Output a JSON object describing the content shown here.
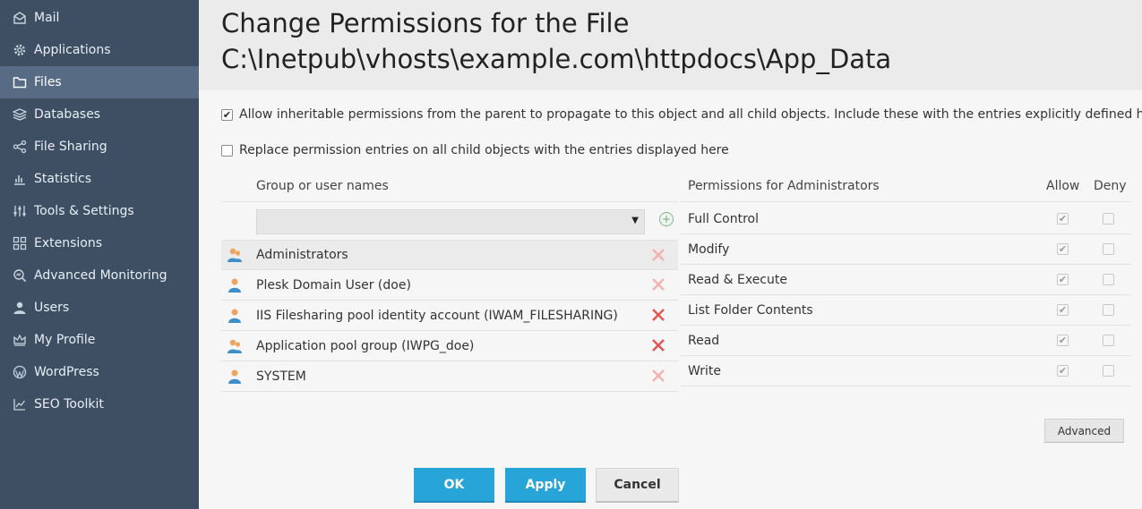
{
  "sidebar": {
    "items": [
      {
        "label": "Mail",
        "icon": "mail-icon",
        "active": false
      },
      {
        "label": "Applications",
        "icon": "gear-icon",
        "active": false
      },
      {
        "label": "Files",
        "icon": "folder-icon",
        "active": true
      },
      {
        "label": "Databases",
        "icon": "stack-icon",
        "active": false
      },
      {
        "label": "File Sharing",
        "icon": "share-icon",
        "active": false
      },
      {
        "label": "Statistics",
        "icon": "bar-chart-icon",
        "active": false
      },
      {
        "label": "Tools & Settings",
        "icon": "sliders-icon",
        "active": false
      },
      {
        "label": "Extensions",
        "icon": "puzzle-grid-icon",
        "active": false
      },
      {
        "label": "Advanced Monitoring",
        "icon": "monitor-search-icon",
        "active": false
      },
      {
        "label": "Users",
        "icon": "user-icon",
        "active": false
      },
      {
        "label": "My Profile",
        "icon": "crown-icon",
        "active": false
      },
      {
        "label": "WordPress",
        "icon": "wordpress-icon",
        "active": false
      },
      {
        "label": "SEO Toolkit",
        "icon": "trend-chart-icon",
        "active": false
      }
    ]
  },
  "header": {
    "title_line1": "Change Permissions for the File",
    "title_line2": "C:\\Inetpub\\vhosts\\example.com\\httpdocs\\App_Data"
  },
  "options": {
    "inherit": {
      "label": "Allow inheritable permissions from the parent to propagate to this object and all child objects. Include these with the entries explicitly defined here",
      "checked": true
    },
    "replace": {
      "label": "Replace permission entries on all child objects with the entries displayed here",
      "checked": false
    }
  },
  "group_list": {
    "header": "Group or user names",
    "select_value": "",
    "items": [
      {
        "name": "Administrators",
        "icon": "user-group-icon",
        "selected": true,
        "remove_enabled": false
      },
      {
        "name": "Plesk Domain User (doe)",
        "icon": "user-icon",
        "selected": false,
        "remove_enabled": false
      },
      {
        "name": "IIS Filesharing pool identity account (IWAM_FILESHARING)",
        "icon": "user-icon",
        "selected": false,
        "remove_enabled": true
      },
      {
        "name": "Application pool group (IWPG_doe)",
        "icon": "user-group-icon",
        "selected": false,
        "remove_enabled": true
      },
      {
        "name": "SYSTEM",
        "icon": "user-icon",
        "selected": false,
        "remove_enabled": false
      }
    ]
  },
  "permissions": {
    "header": "Permissions for Administrators",
    "allow_header": "Allow",
    "deny_header": "Deny",
    "items": [
      {
        "label": "Full Control",
        "allow": true,
        "deny": false
      },
      {
        "label": "Modify",
        "allow": true,
        "deny": false
      },
      {
        "label": "Read & Execute",
        "allow": true,
        "deny": false
      },
      {
        "label": "List Folder Contents",
        "allow": true,
        "deny": false
      },
      {
        "label": "Read",
        "allow": true,
        "deny": false
      },
      {
        "label": "Write",
        "allow": true,
        "deny": false
      }
    ]
  },
  "buttons": {
    "advanced": "Advanced",
    "ok": "OK",
    "apply": "Apply",
    "cancel": "Cancel"
  },
  "colors": {
    "sidebar_bg": "#3e4f63",
    "sidebar_active": "#576c84",
    "primary": "#28a5d8",
    "remove_red": "#e2554f"
  }
}
